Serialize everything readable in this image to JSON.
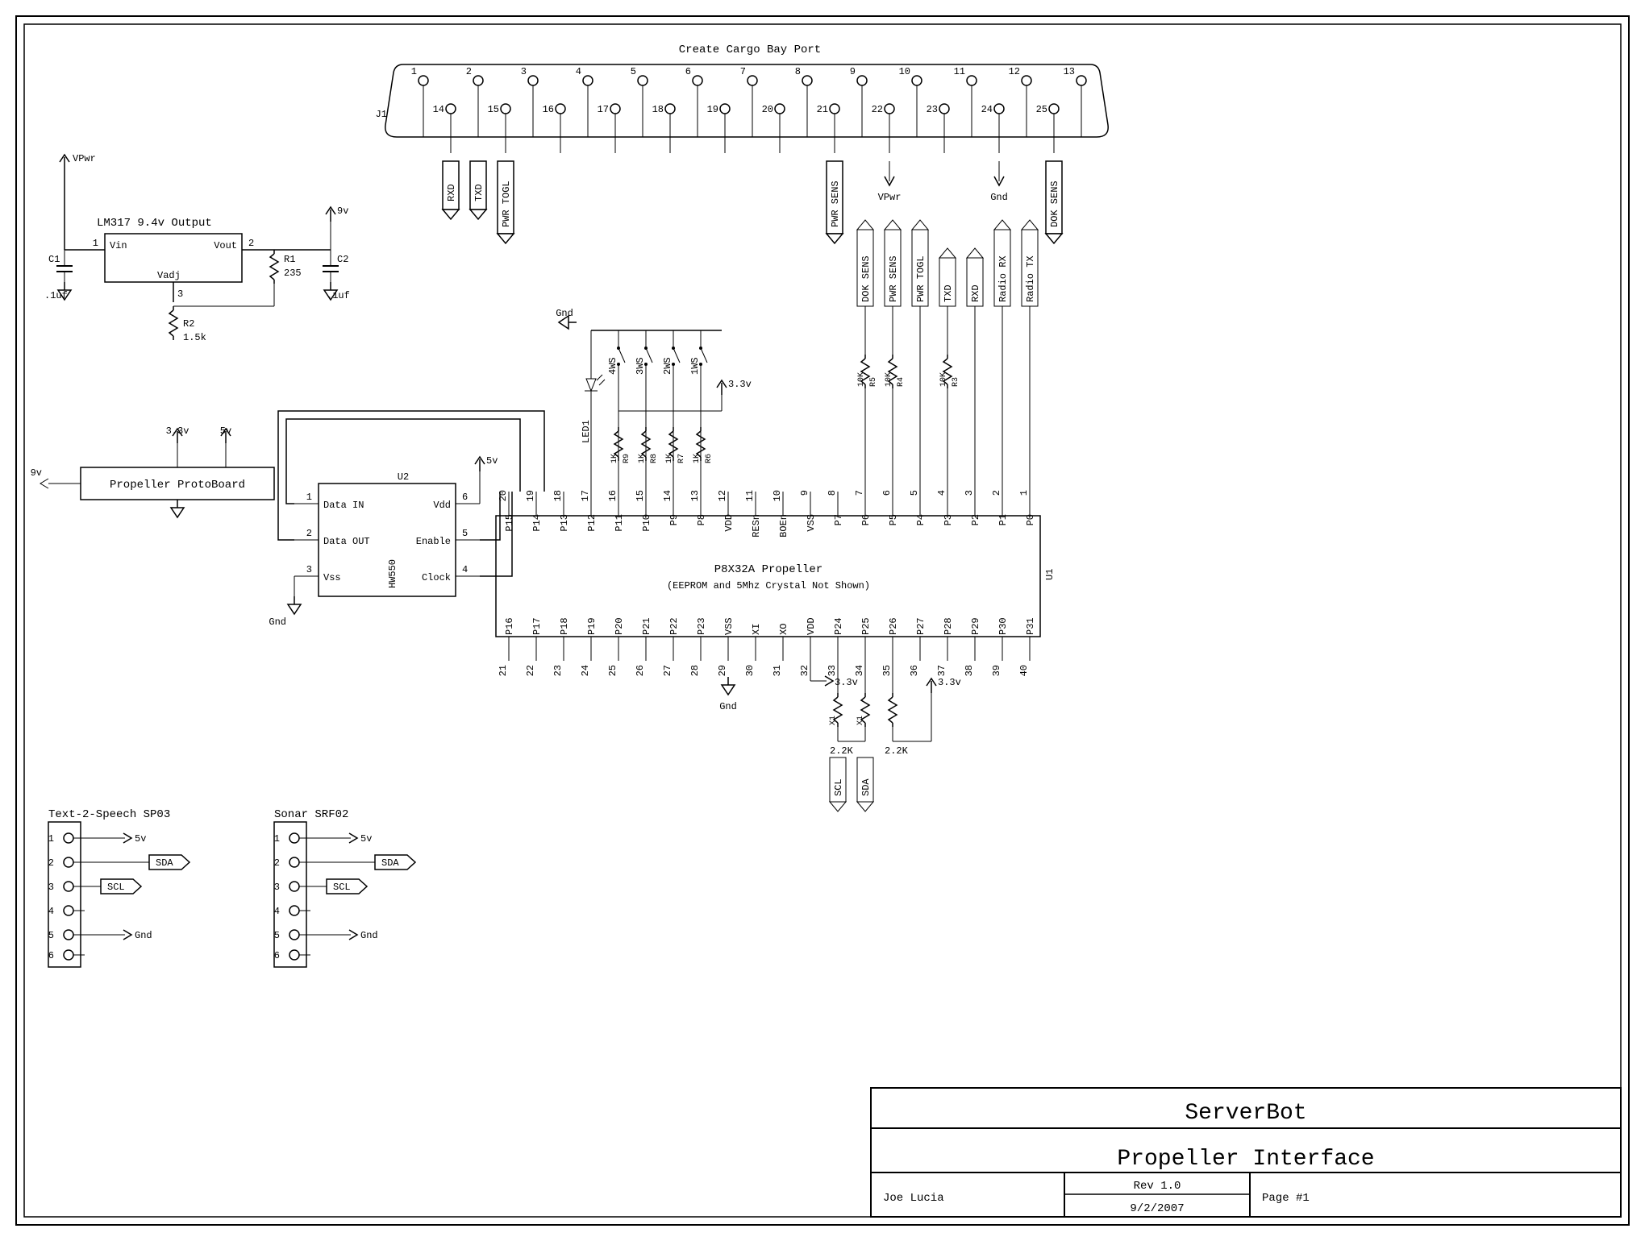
{
  "title_block": {
    "product": "ServerBot",
    "subtitle": "Propeller Interface",
    "author": "Joe Lucia",
    "rev": "Rev 1.0",
    "date": "9/2/2007",
    "page": "Page #1"
  },
  "cargo_port": {
    "title": "Create Cargo Bay Port",
    "ref": "J1",
    "top_pins": [
      "1",
      "2",
      "3",
      "4",
      "5",
      "6",
      "7",
      "8",
      "9",
      "10",
      "11",
      "12",
      "13"
    ],
    "bot_pins": [
      "14",
      "15",
      "16",
      "17",
      "18",
      "19",
      "20",
      "21",
      "22",
      "23",
      "24",
      "25"
    ],
    "labels": {
      "rxd": "RXD",
      "txd": "TXD",
      "pwr_togl": "PWR TOGL",
      "pwr_sens": "PWR SENS",
      "dok_sens": "DOK SENS"
    },
    "vpwr": "VPwr",
    "gnd": "Gnd"
  },
  "regulator": {
    "title": "LM317 9.4v Output",
    "vpwr": "VPwr",
    "nine": "9v",
    "vin": "Vin",
    "vout": "Vout",
    "vadj": "Vadj",
    "pin1": "1",
    "pin2": "2",
    "pin3": "3",
    "c1": "C1",
    "c1v": ".1uf",
    "c2": "C2",
    "c2v": ".1uf",
    "r1": "R1",
    "r1v": "235",
    "r2": "R2",
    "r2v": "1.5k"
  },
  "protoboard": {
    "name": "Propeller ProtoBoard",
    "in": "9v",
    "v33": "3.3v",
    "v5": "5v"
  },
  "u2": {
    "ref": "U2",
    "part": "HW550",
    "pins": {
      "p1": "1",
      "p2": "2",
      "p3": "3",
      "p4": "4",
      "p5": "5",
      "p6": "6"
    },
    "lbl": {
      "din": "Data IN",
      "dout": "Data OUT",
      "vss": "Vss",
      "clk": "Clock",
      "en": "Enable",
      "vdd": "Vdd"
    },
    "v5": "5v",
    "gnd": "Gnd"
  },
  "u1": {
    "ref": "U1",
    "name": "P8X32A Propeller",
    "note": "(EEPROM and 5Mhz Crystal Not Shown)",
    "top_nums": [
      "20",
      "19",
      "18",
      "17",
      "16",
      "15",
      "14",
      "13",
      "12",
      "11",
      "10",
      "9",
      "8",
      "7",
      "6",
      "5",
      "4",
      "3",
      "2",
      "1"
    ],
    "top_lbls": [
      "P15",
      "P14",
      "P13",
      "P12",
      "P11",
      "P10",
      "P9",
      "P8",
      "VDD",
      "RESn",
      "BOEn",
      "VSS",
      "P7",
      "P6",
      "P5",
      "P4",
      "P3",
      "P2",
      "P1",
      "P0"
    ],
    "bot_nums": [
      "21",
      "22",
      "23",
      "24",
      "25",
      "26",
      "27",
      "28",
      "29",
      "30",
      "31",
      "32",
      "33",
      "34",
      "35",
      "36",
      "37",
      "38",
      "39",
      "40"
    ],
    "bot_lbls": [
      "P16",
      "P17",
      "P18",
      "P19",
      "P20",
      "P21",
      "P22",
      "P23",
      "VSS",
      "XI",
      "XO",
      "VDD",
      "P24",
      "P25",
      "P26",
      "P27",
      "P28",
      "P29",
      "P30",
      "P31"
    ]
  },
  "top_res": {
    "led": "LED1",
    "sw": [
      "4WS",
      "3WS",
      "2WS",
      "1WS"
    ],
    "gnd": "Gnd",
    "v33": "3.3v",
    "r9": "R9",
    "r9v": "1K",
    "r8": "R8",
    "r8v": "1K",
    "r7": "R7",
    "r7v": "1K",
    "r6": "R6",
    "r6v": "1K"
  },
  "right_top": {
    "radio_tx": "Radio TX",
    "radio_rx": "Radio RX",
    "rxd": "RXD",
    "txd": "TXD",
    "pwr_togl": "PWR TOGL",
    "pwr_sens": "PWR SENS",
    "dok_sens": "DOK SENS",
    "r3": "R3",
    "r3v": "10K",
    "r4": "R4",
    "r4v": "10K",
    "r5": "R5",
    "r5v": "10K"
  },
  "bottom_i2c": {
    "gnd": "Gnd",
    "v33a": "3.3v",
    "v33b": "3.3v",
    "x1": "X1",
    "x2": "X1",
    "k22a": "2.2K",
    "k22b": "2.2K",
    "scl": "SCL",
    "sda": "SDA"
  },
  "tts": {
    "title": "Text-2-Speech SP03",
    "pins": [
      "1",
      "2",
      "3",
      "4",
      "5",
      "6"
    ],
    "sda": "SDA",
    "scl": "SCL",
    "v5": "5v",
    "gnd": "Gnd"
  },
  "sonar": {
    "title": "Sonar SRF02",
    "pins": [
      "1",
      "2",
      "3",
      "4",
      "5",
      "6"
    ],
    "sda": "SDA",
    "scl": "SCL",
    "v5": "5v",
    "gnd": "Gnd"
  }
}
